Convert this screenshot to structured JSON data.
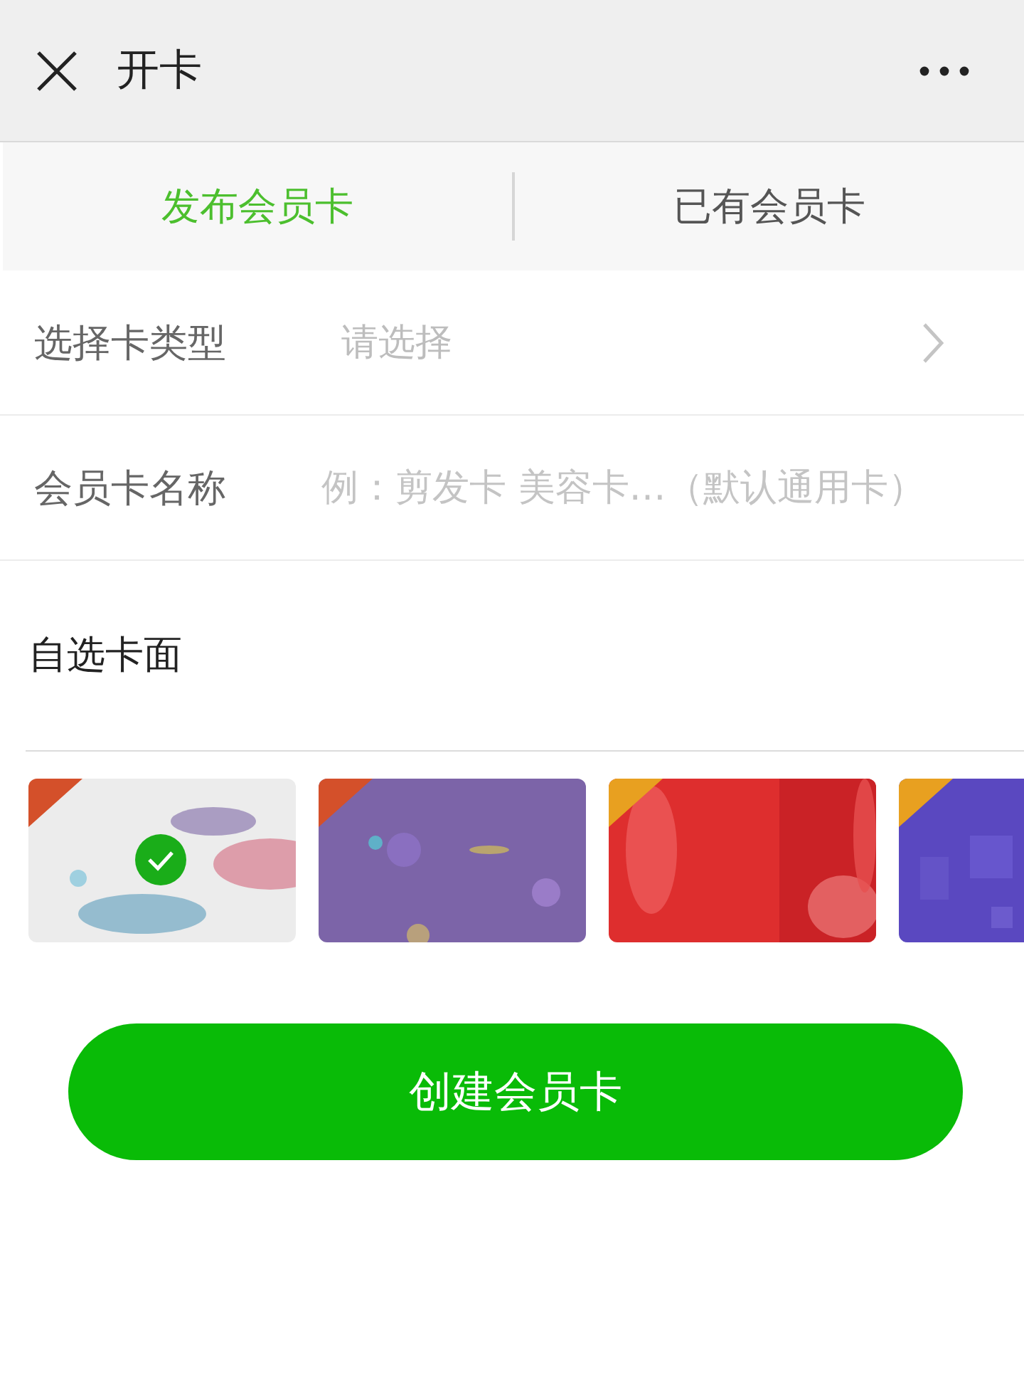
{
  "header": {
    "title": "开卡"
  },
  "tabs": [
    {
      "label": "发布会员卡",
      "selected": true
    },
    {
      "label": "已有会员卡",
      "selected": false
    }
  ],
  "fields": [
    {
      "kind": "select",
      "label": "选择卡类型",
      "placeholder": "请选择"
    },
    {
      "kind": "input",
      "label": "会员卡名称",
      "placeholder": "例：剪发卡 美容卡…（默认通用卡）"
    }
  ],
  "cover_section": {
    "title": "自选卡面"
  },
  "covers": [
    {
      "kind": "picture",
      "selected": true
    },
    {
      "kind": "picture",
      "selected": false
    },
    {
      "kind": "picture",
      "selected": false
    },
    {
      "kind": "picture",
      "selected": false
    }
  ],
  "submit_button": {
    "label": "创建会员卡"
  }
}
